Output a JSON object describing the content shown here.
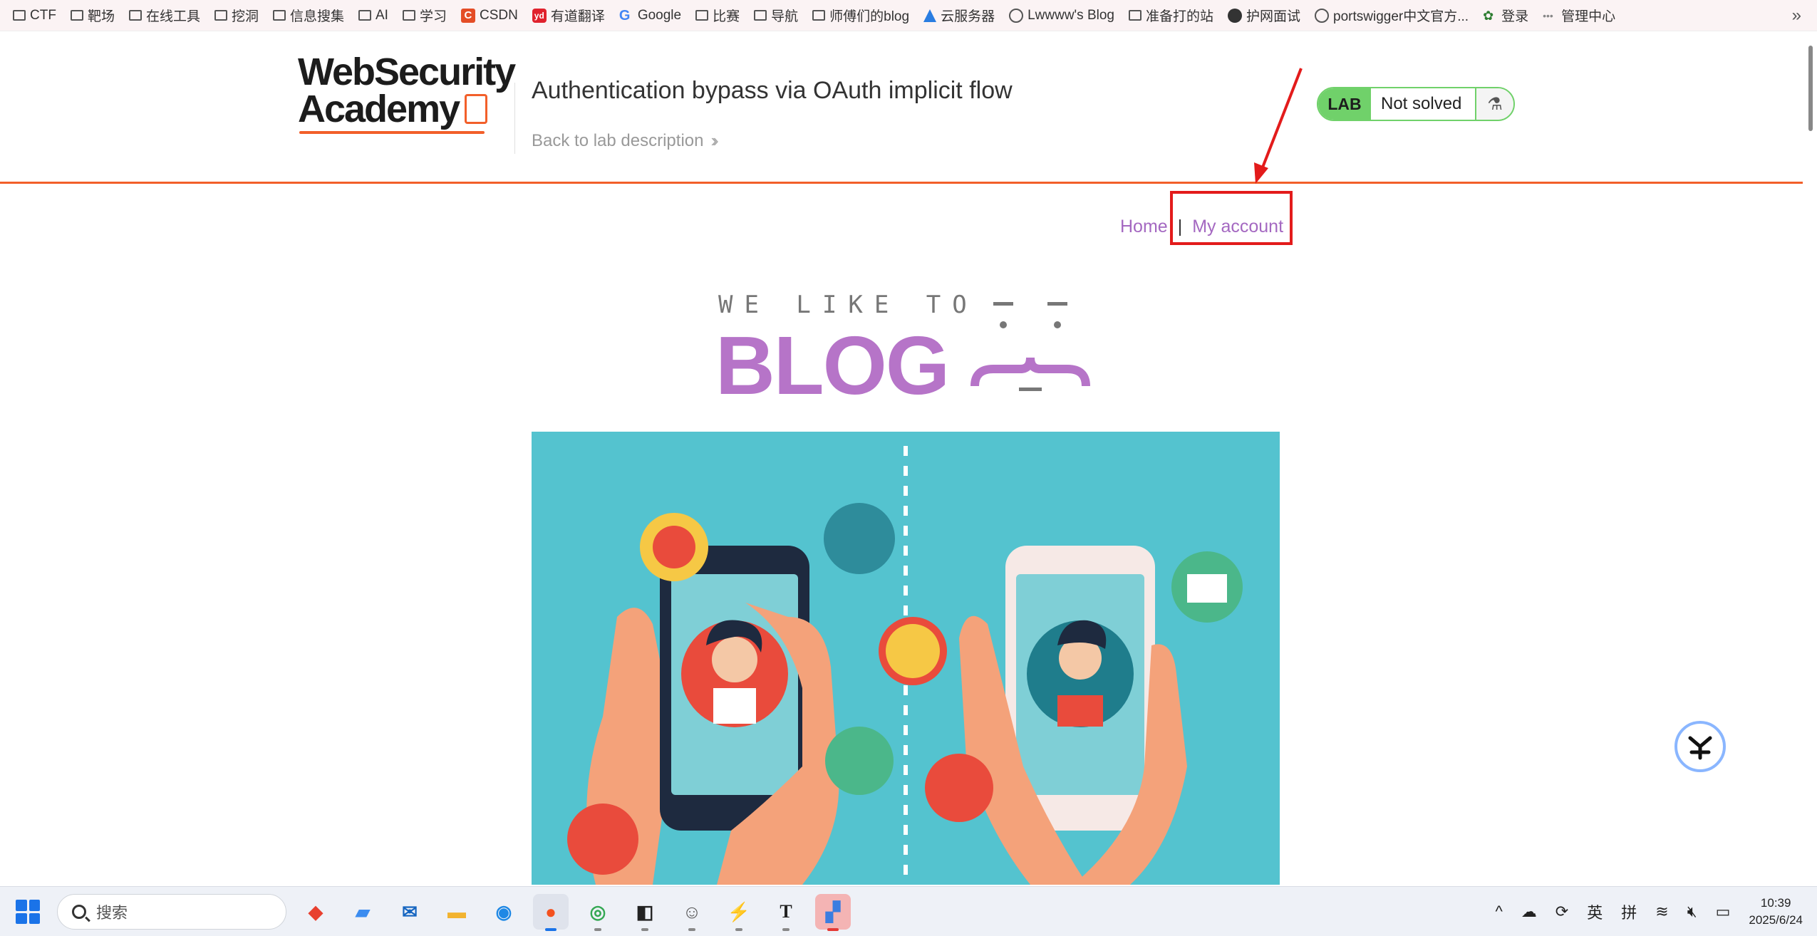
{
  "bookmarks": [
    {
      "label": "CTF",
      "icon": "folder-icon"
    },
    {
      "label": "靶场",
      "icon": "folder-icon"
    },
    {
      "label": "在线工具",
      "icon": "folder-icon"
    },
    {
      "label": "挖洞",
      "icon": "folder-icon"
    },
    {
      "label": "信息搜集",
      "icon": "folder-icon"
    },
    {
      "label": "AI",
      "icon": "folder-icon"
    },
    {
      "label": "学习",
      "icon": "folder-icon"
    },
    {
      "label": "CSDN",
      "icon": "csdn-icon"
    },
    {
      "label": "有道翻译",
      "icon": "youdao-icon"
    },
    {
      "label": "Google",
      "icon": "google-icon"
    },
    {
      "label": "比赛",
      "icon": "folder-icon"
    },
    {
      "label": "导航",
      "icon": "folder-icon"
    },
    {
      "label": "师傅们的blog",
      "icon": "folder-icon"
    },
    {
      "label": "云服务器",
      "icon": "cloud-icon"
    },
    {
      "label": "Lwwww's Blog",
      "icon": "globe-icon"
    },
    {
      "label": "准备打的站",
      "icon": "folder-icon"
    },
    {
      "label": "护网面试",
      "icon": "site-icon"
    },
    {
      "label": "portswigger中文官方...",
      "icon": "globe-icon"
    },
    {
      "label": "登录",
      "icon": "leaf-icon"
    },
    {
      "label": "管理中心",
      "icon": "site-icon"
    }
  ],
  "lab": {
    "logo_line1": "WebSecurity",
    "logo_line2": "Academy",
    "title": "Authentication bypass via OAuth implicit flow",
    "back_link": "Back to lab description",
    "badge": "LAB",
    "status": "Not solved"
  },
  "nav": {
    "home": "Home",
    "separator": "|",
    "my_account": "My account"
  },
  "banner": {
    "tagline": "WE LIKE TO",
    "word": "BLOG"
  },
  "taskbar": {
    "search_placeholder": "搜索",
    "ime_lang": "英",
    "ime_mode": "拼",
    "time": "10:39",
    "date": "2025/6/24"
  },
  "colors": {
    "accent": "#f25f2a",
    "link": "#a468c1",
    "lab_green": "#70d16a",
    "hero_bg": "#54c3cf",
    "annotation": "#e31b1b"
  }
}
